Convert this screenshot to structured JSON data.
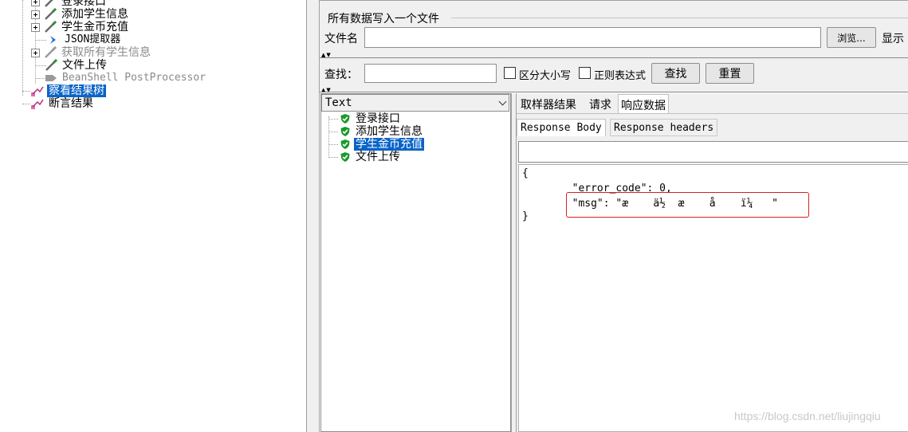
{
  "tree": {
    "items": [
      {
        "label": "登录接口",
        "disabled": false
      },
      {
        "label": "添加学生信息",
        "disabled": false
      },
      {
        "label": "学生金币充值",
        "disabled": false
      },
      {
        "label": "JSON提取器",
        "disabled": false
      },
      {
        "label": "获取所有学生信息",
        "disabled": true
      },
      {
        "label": "文件上传",
        "disabled": false
      },
      {
        "label": "BeanShell PostProcessor",
        "disabled": true
      },
      {
        "label": "察看结果树",
        "selected": true
      },
      {
        "label": "断言结果",
        "disabled": false
      }
    ]
  },
  "file_section": {
    "title": "所有数据写入一个文件",
    "filename_label": "文件名",
    "filename_value": "",
    "browse_label": "浏览...",
    "display_label": "显示"
  },
  "search": {
    "label": "查找：",
    "value": "",
    "case_sensitive_label": "区分大小写",
    "regex_label": "正则表达式",
    "find_button": "查找",
    "reset_button": "重置"
  },
  "result_tree": {
    "renderer": "Text",
    "samples": [
      "登录接口",
      "添加学生信息",
      "学生金币充值",
      "文件上传"
    ],
    "selected_index": 2
  },
  "tabs": [
    "取样器结果",
    "请求",
    "响应数据"
  ],
  "active_tab": "响应数据",
  "sub_tabs": [
    "Response Body",
    "Response headers"
  ],
  "response_body": {
    "line1": "{",
    "line2": "        \"error_code\": 0,",
    "line3": "        \"msg\": \"æ    ä½  æ    å    ï¼   \"",
    "line4": "}"
  },
  "watermark": "https://blog.csdn.net/liujingqiu",
  "colors": {
    "selection": "#0a64c8",
    "highlight_border": "#d62020",
    "shield_green": "#1a9a2a"
  }
}
